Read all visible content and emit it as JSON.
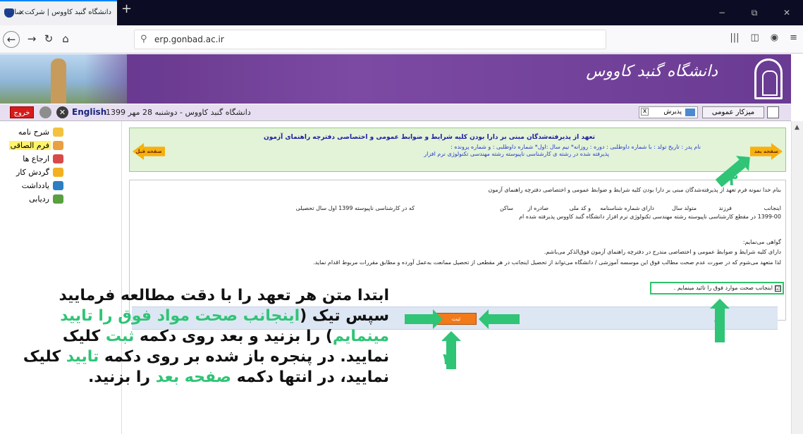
{
  "browser": {
    "tab_title": "دانشگاه گنبد کاووس | شرکت سا...",
    "tab_close": "×",
    "new_tab": "+",
    "url": "erp.gonbad.ac.ir",
    "window_controls": [
      "−",
      "⧉",
      "✕"
    ]
  },
  "header": {
    "logo_text": "دانشگاه گنبد کاووس",
    "exit_label": "خروج",
    "language_label": "English",
    "date_text": "دانشگاه گنبد کاووس - دوشنبه 28 مهر 1399",
    "filter_label": "پذیرش",
    "general_menu_label": "میزکار عمومی"
  },
  "sidebar": {
    "items": [
      {
        "label": "شرح نامه",
        "highlighted": false,
        "icon_color": "#f3c240"
      },
      {
        "label": "فرم الصاقی",
        "highlighted": true,
        "icon_color": "#e8a040"
      },
      {
        "label": "ارجاع ها",
        "highlighted": false,
        "icon_color": "#d84a4a"
      },
      {
        "label": "گردش کار",
        "highlighted": false,
        "icon_color": "#f3b020"
      },
      {
        "label": "یادداشت",
        "highlighted": false,
        "icon_color": "#2d7fc2"
      },
      {
        "label": "ردیابی",
        "highlighted": false,
        "icon_color": "#5aa040"
      }
    ]
  },
  "form_header": {
    "title": "تعهد از پذیرفته‌شدگان مبنی بر دارا بودن کلیه شرایط و ضوابط عمومی و اختصاصی دفترچه راهنمای آزمون",
    "fields_line": "نام پدر :      تاریخ تولد :      با شماره داوطلبی :      دوره : روزانه* نیم سال :اول* شماره داوطلبی :      و شماره پرونده :",
    "accepted_line": "پذیرفته شده در رشته ی کارشناسی ناپیوسته رشته مهندسی تکنولوژی نرم افزار",
    "next_label": "صفحه بعد",
    "prev_label": "صفحه قبل"
  },
  "content": {
    "line1": "بنام خدا نمونه فرم تعهد از پذیرفته‌شدگان مبنی بر دارا بودن کلیه شرایط و ضوابط عمومی و اختصاصی دفترچه راهنمای آزمون",
    "line2_parts": [
      "اینجانب",
      "فرزند",
      "متولد سال",
      "دارای شماره شناسنامه",
      "و کد ملی",
      "صادره از",
      "ساکن",
      "که در کارشناسی ناپیوسته 1399 اول سال تحصیلی"
    ],
    "line3": "1399-00 در مقطع کارشناسی ناپیوسته رشته مهندسی تکنولوژی نرم افزار دانشگاه گنبد کاووس پذیرفته شده ام",
    "line4": "گواهی می‌نمایم:",
    "line5": "دارای کلیه شرایط و ضوابط عمومی و اختصاصی مندرج در دفترچه راهنمای آزمون فوق‌الذکر می‌باشم.",
    "line6": "لذا متعهد می‌شوم که در صورت عدم صحت مطالب فوق این موسسه آموزشی / دانشگاه می‌تواند از تحصیل اینجانب در هر مقطعی از تحصیل ممانعت به‌عمل آورده و مطابق مقررات مربوط اقدام نماید.",
    "checkbox_label": "اینجانب صحت موارد فوق را تائید مینمایم .",
    "checkbox_checked": "☑",
    "submit_label": "ثبت"
  },
  "annotations": {
    "numbers": [
      "۱",
      "۲",
      "۳"
    ],
    "instructions": [
      {
        "text": "ابتدا متن هر تعهد را با دقت مطالعه فرمایید",
        "green": false
      },
      {
        "text": "سپس تیک (",
        "green": false
      },
      {
        "text": "اینجانب صحت مواد فوق را تایید مینمایم",
        "green": true
      },
      {
        "text": ") را بزنید و بعد روی دکمه ",
        "green": false
      },
      {
        "text": "ثبت",
        "green": true
      },
      {
        "text": " کلیک نمایید. در پنجره باز شده بر روی دکمه ",
        "green": false
      },
      {
        "text": "تایید",
        "green": true
      },
      {
        "text": " کلیک نمایید، در انتها دکمه ",
        "green": false
      },
      {
        "text": "صفحه بعد",
        "green": true
      },
      {
        "text": " را بزنید.",
        "green": false
      }
    ],
    "accent_color": "#2fc476"
  }
}
